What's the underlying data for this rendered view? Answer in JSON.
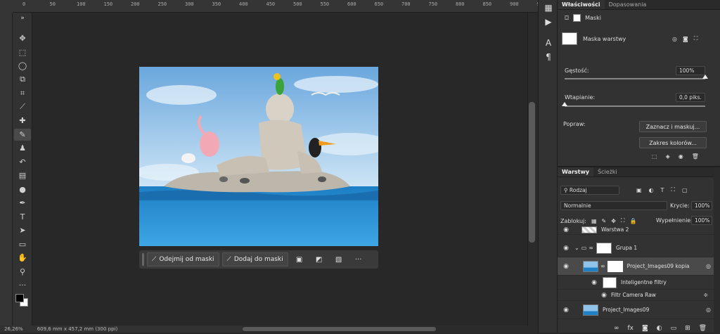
{
  "ruler": {
    "ticks": [
      "0",
      "50",
      "100",
      "150",
      "200",
      "250",
      "300",
      "350",
      "400",
      "450",
      "500",
      "550",
      "600",
      "650",
      "700",
      "750",
      "800",
      "850",
      "900",
      "950"
    ]
  },
  "toolbar": {
    "collapse": "»",
    "tools": [
      {
        "name": "move-icon",
        "glyph": "✥"
      },
      {
        "name": "marquee-icon",
        "glyph": "⬚"
      },
      {
        "name": "lasso-icon",
        "glyph": "◯"
      },
      {
        "name": "object-select-icon",
        "glyph": "⧉"
      },
      {
        "name": "crop-icon",
        "glyph": "⌗"
      },
      {
        "name": "eyedropper-icon",
        "glyph": "⟋"
      },
      {
        "name": "healing-brush-icon",
        "glyph": "✚"
      },
      {
        "name": "brush-icon",
        "glyph": "✎"
      },
      {
        "name": "stamp-icon",
        "glyph": "♟"
      },
      {
        "name": "history-brush-icon",
        "glyph": "↶"
      },
      {
        "name": "gradient-icon",
        "glyph": "▤"
      },
      {
        "name": "dodge-icon",
        "glyph": "●"
      },
      {
        "name": "pen-icon",
        "glyph": "✒"
      },
      {
        "name": "type-icon",
        "glyph": "T"
      },
      {
        "name": "path-select-icon",
        "glyph": "➤"
      },
      {
        "name": "rectangle-icon",
        "glyph": "▭"
      },
      {
        "name": "hand-icon",
        "glyph": "✋"
      },
      {
        "name": "zoom-icon",
        "glyph": "⚲"
      },
      {
        "name": "more-tools-icon",
        "glyph": "···"
      }
    ]
  },
  "taskbar": {
    "subtract": "Odejmij od maski",
    "add": "Dodaj do maski",
    "more": "···"
  },
  "status": {
    "zoom": "26,26%",
    "size": "609,6 mm x 457,2 mm (300 ppi)"
  },
  "properties": {
    "tabs": [
      "Właściwości",
      "Dopasowania"
    ],
    "masks_label": "Maski",
    "layer_mask_label": "Maska warstwy",
    "density_label": "Gęstość:",
    "density_value": "100%",
    "density_level": 1.0,
    "feather_label": "Wtapianie:",
    "feather_value": "0,0 piks.",
    "feather_level": 0.0,
    "refine_label": "Popraw:",
    "select_mask_btn": "Zaznacz i maskuj...",
    "color_range_btn": "Zakres kolorów..."
  },
  "layers": {
    "tabs": [
      "Warstwy",
      "Ścieżki"
    ],
    "filter_kind": "Rodzaj",
    "blend_mode": "Normalnie",
    "opacity_label": "Krycie:",
    "opacity_value": "100%",
    "lock_label": "Zablokuj:",
    "fill_label": "Wypełnienie:",
    "fill_value": "100%",
    "items": [
      {
        "name": "Warstwa 2"
      },
      {
        "name": "Grupa 1"
      },
      {
        "name": "Project_Images09 kopia"
      },
      {
        "name": "Inteligentne filtry"
      },
      {
        "name": "Filtr Camera Raw"
      },
      {
        "name": "Project_Images09"
      }
    ],
    "footer": {
      "fx": "fx"
    }
  },
  "colors": {
    "accent": "#1473e6",
    "panel": "#323232",
    "canvas": "#282828"
  }
}
